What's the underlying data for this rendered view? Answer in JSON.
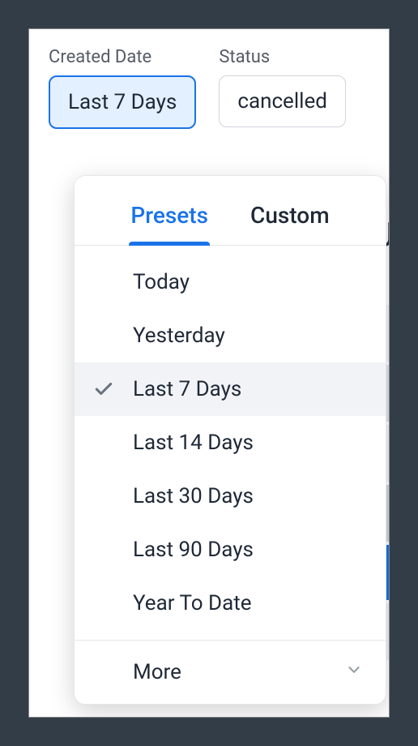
{
  "filters": {
    "created_date": {
      "label": "Created Date",
      "value": "Last 7 Days"
    },
    "status": {
      "label": "Status",
      "value": "cancelled"
    }
  },
  "dropdown": {
    "tabs": {
      "presets": "Presets",
      "custom": "Custom",
      "active": "presets"
    },
    "options": [
      {
        "label": "Today",
        "selected": false
      },
      {
        "label": "Yesterday",
        "selected": false
      },
      {
        "label": "Last 7 Days",
        "selected": true
      },
      {
        "label": "Last 14 Days",
        "selected": false
      },
      {
        "label": "Last 30 Days",
        "selected": false
      },
      {
        "label": "Last 90 Days",
        "selected": false
      },
      {
        "label": "Year To Date",
        "selected": false
      }
    ],
    "more_label": "More"
  },
  "background_hint": "U"
}
